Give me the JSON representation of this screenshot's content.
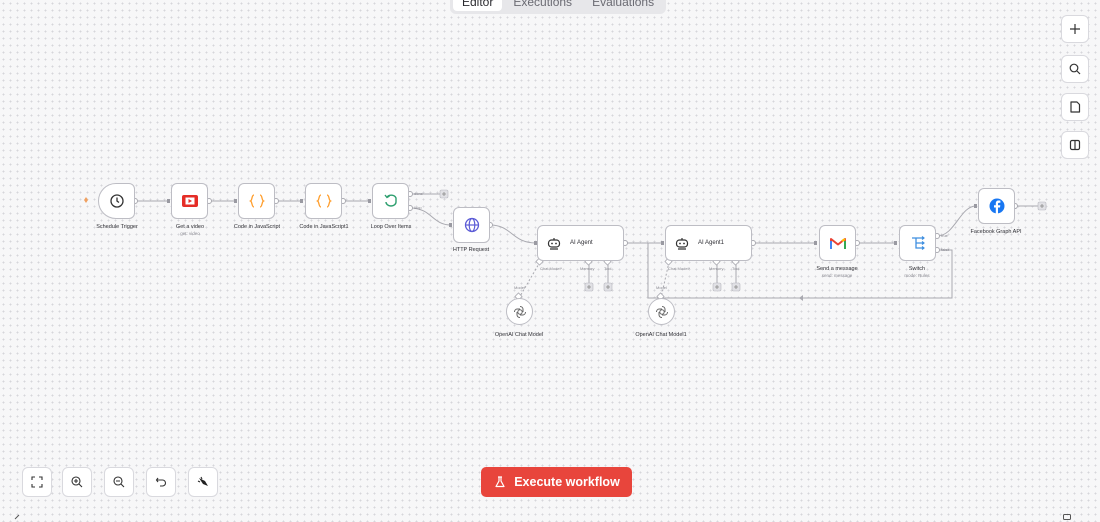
{
  "tabs": [
    {
      "label": "Editor",
      "active": true
    },
    {
      "label": "Executions",
      "active": false
    },
    {
      "label": "Evaluations",
      "active": false
    }
  ],
  "right_toolbar": [
    "plus-icon",
    "search-icon",
    "sticky-note-icon",
    "panel-icon"
  ],
  "bottom_toolbar": [
    "fit-view-icon",
    "zoom-in-icon",
    "zoom-out-icon",
    "reset-zoom-icon",
    "tidy-up-icon"
  ],
  "execute_button": {
    "label": "Execute workflow",
    "color": "#e8453c",
    "icon": "flask-icon"
  },
  "nodes": {
    "schedule_trigger": {
      "label": "Schedule Trigger",
      "icon": "clock-icon"
    },
    "get_video": {
      "label": "Get a video",
      "sub": "get: video",
      "icon": "youtube-icon"
    },
    "code_js": {
      "label": "Code in JavaScript",
      "icon": "braces-icon"
    },
    "code_js1": {
      "label": "Code in JavaScript1",
      "icon": "braces-icon"
    },
    "loop": {
      "label": "Loop Over Items",
      "icon": "loop-icon",
      "ports": [
        "done",
        "loop"
      ]
    },
    "http": {
      "label": "HTTP Request",
      "icon": "globe-icon"
    },
    "agent": {
      "label": "AI Agent",
      "icon": "robot-icon",
      "ports": [
        "Chat Model*",
        "Memory",
        "Tool"
      ]
    },
    "agent1": {
      "label": "AI Agent1",
      "icon": "robot-icon",
      "ports": [
        "Chat Model*",
        "Memory",
        "Tool"
      ]
    },
    "gmail": {
      "label": "Send a message",
      "sub": "send: message",
      "icon": "gmail-icon"
    },
    "switch": {
      "label": "Switch",
      "sub": "mode: Rules",
      "icon": "switch-icon",
      "ports": [
        "true",
        "false"
      ]
    },
    "facebook": {
      "label": "Facebook Graph API",
      "icon": "facebook-icon"
    },
    "openai": {
      "label": "OpenAI Chat Model",
      "icon": "openai-icon",
      "port": "Model"
    },
    "openai1": {
      "label": "OpenAI Chat Model1",
      "icon": "openai-icon",
      "port": "Model"
    }
  }
}
